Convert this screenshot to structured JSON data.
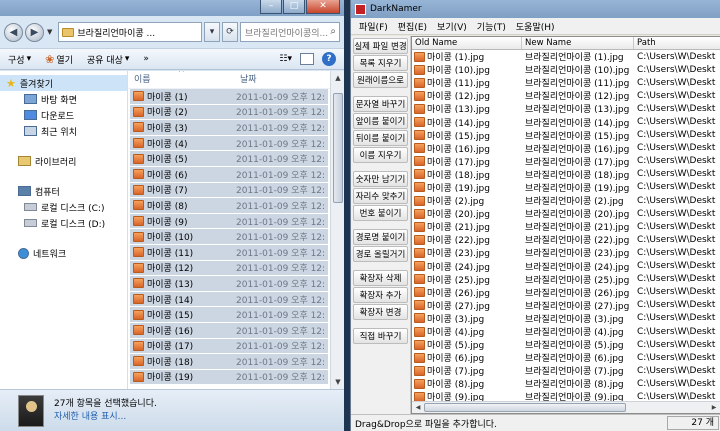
{
  "explorer": {
    "address": "브라질리언마이콩 ...",
    "search_placeholder": "브라질리언마이콩의...",
    "toolbar": {
      "organize": "구성",
      "open": "열기",
      "share": "공유 대상",
      "more": "»"
    },
    "nav": {
      "favorites": "즐겨찾기",
      "desktop": "바탕 화면",
      "downloads": "다운로드",
      "recent": "최근 위치",
      "libraries": "라이브러리",
      "computer": "컴퓨터",
      "drive_c": "로컬 디스크 (C:)",
      "drive_d": "로컬 디스크 (D:)",
      "network": "네트워크"
    },
    "columns": {
      "name": "이름",
      "date": "날짜"
    },
    "files": [
      {
        "name": "마이콩 (1)",
        "date": "2011-01-09 오후 12:"
      },
      {
        "name": "마이콩 (2)",
        "date": "2011-01-09 오후 12:"
      },
      {
        "name": "마이콩 (3)",
        "date": "2011-01-09 오후 12:"
      },
      {
        "name": "마이콩 (4)",
        "date": "2011-01-09 오후 12:"
      },
      {
        "name": "마이콩 (5)",
        "date": "2011-01-09 오후 12:"
      },
      {
        "name": "마이콩 (6)",
        "date": "2011-01-09 오후 12:"
      },
      {
        "name": "마이콩 (7)",
        "date": "2011-01-09 오후 12:"
      },
      {
        "name": "마이콩 (8)",
        "date": "2011-01-09 오후 12:"
      },
      {
        "name": "마이콩 (9)",
        "date": "2011-01-09 오후 12:"
      },
      {
        "name": "마이콩 (10)",
        "date": "2011-01-09 오후 12:"
      },
      {
        "name": "마이콩 (11)",
        "date": "2011-01-09 오후 12:"
      },
      {
        "name": "마이콩 (12)",
        "date": "2011-01-09 오후 12:"
      },
      {
        "name": "마이콩 (13)",
        "date": "2011-01-09 오후 12:"
      },
      {
        "name": "마이콩 (14)",
        "date": "2011-01-09 오후 12:"
      },
      {
        "name": "마이콩 (15)",
        "date": "2011-01-09 오후 12:"
      },
      {
        "name": "마이콩 (16)",
        "date": "2011-01-09 오후 12:"
      },
      {
        "name": "마이콩 (17)",
        "date": "2011-01-09 오후 12:"
      },
      {
        "name": "마이콩 (18)",
        "date": "2011-01-09 오후 12:"
      },
      {
        "name": "마이콩 (19)",
        "date": "2011-01-09 오후 12:"
      }
    ],
    "status": {
      "selected": "27개 항목을 선택했습니다.",
      "details": "자세한 내용 표시..."
    }
  },
  "darknamer": {
    "title": "DarkNamer",
    "menu": [
      "파일(F)",
      "편집(E)",
      "보기(V)",
      "기능(T)",
      "도움말(H)"
    ],
    "buttons": [
      "실제 파일 변경",
      "목록 지우기",
      "원래이름으로",
      "문자열 바꾸기",
      "앞이름 붙이기",
      "뒤이름 붙이기",
      "이름 지우기",
      "숫자만 남기기",
      "자리수 맞추기",
      "번호 붙이기",
      "경로명 붙이기",
      "경로 올릴거기",
      "확장자 삭제",
      "확장자 추가",
      "확장자 변경",
      "직접 바꾸기"
    ],
    "columns": {
      "old": "Old Name",
      "new": "New Name",
      "path": "Path"
    },
    "rows": [
      {
        "old": "마이콩 (1).jpg",
        "new": "브라질리언마이콩 (1).jpg",
        "path": "C:\\Users\\W\\Deskt"
      },
      {
        "old": "마이콩 (10).jpg",
        "new": "브라질리언마이콩 (10).jpg",
        "path": "C:\\Users\\W\\Deskt"
      },
      {
        "old": "마이콩 (11).jpg",
        "new": "브라질리언마이콩 (11).jpg",
        "path": "C:\\Users\\W\\Deskt"
      },
      {
        "old": "마이콩 (12).jpg",
        "new": "브라질리언마이콩 (12).jpg",
        "path": "C:\\Users\\W\\Deskt"
      },
      {
        "old": "마이콩 (13).jpg",
        "new": "브라질리언마이콩 (13).jpg",
        "path": "C:\\Users\\W\\Deskt"
      },
      {
        "old": "마이콩 (14).jpg",
        "new": "브라질리언마이콩 (14).jpg",
        "path": "C:\\Users\\W\\Deskt"
      },
      {
        "old": "마이콩 (15).jpg",
        "new": "브라질리언마이콩 (15).jpg",
        "path": "C:\\Users\\W\\Deskt"
      },
      {
        "old": "마이콩 (16).jpg",
        "new": "브라질리언마이콩 (16).jpg",
        "path": "C:\\Users\\W\\Deskt"
      },
      {
        "old": "마이콩 (17).jpg",
        "new": "브라질리언마이콩 (17).jpg",
        "path": "C:\\Users\\W\\Deskt"
      },
      {
        "old": "마이콩 (18).jpg",
        "new": "브라질리언마이콩 (18).jpg",
        "path": "C:\\Users\\W\\Deskt"
      },
      {
        "old": "마이콩 (19).jpg",
        "new": "브라질리언마이콩 (19).jpg",
        "path": "C:\\Users\\W\\Deskt"
      },
      {
        "old": "마이콩 (2).jpg",
        "new": "브라질리언마이콩 (2).jpg",
        "path": "C:\\Users\\W\\Deskt"
      },
      {
        "old": "마이콩 (20).jpg",
        "new": "브라질리언마이콩 (20).jpg",
        "path": "C:\\Users\\W\\Deskt"
      },
      {
        "old": "마이콩 (21).jpg",
        "new": "브라질리언마이콩 (21).jpg",
        "path": "C:\\Users\\W\\Deskt"
      },
      {
        "old": "마이콩 (22).jpg",
        "new": "브라질리언마이콩 (22).jpg",
        "path": "C:\\Users\\W\\Deskt"
      },
      {
        "old": "마이콩 (23).jpg",
        "new": "브라질리언마이콩 (23).jpg",
        "path": "C:\\Users\\W\\Deskt"
      },
      {
        "old": "마이콩 (24).jpg",
        "new": "브라질리언마이콩 (24).jpg",
        "path": "C:\\Users\\W\\Deskt"
      },
      {
        "old": "마이콩 (25).jpg",
        "new": "브라질리언마이콩 (25).jpg",
        "path": "C:\\Users\\W\\Deskt"
      },
      {
        "old": "마이콩 (26).jpg",
        "new": "브라질리언마이콩 (26).jpg",
        "path": "C:\\Users\\W\\Deskt"
      },
      {
        "old": "마이콩 (27).jpg",
        "new": "브라질리언마이콩 (27).jpg",
        "path": "C:\\Users\\W\\Deskt"
      },
      {
        "old": "마이콩 (3).jpg",
        "new": "브라질리언마이콩 (3).jpg",
        "path": "C:\\Users\\W\\Deskt"
      },
      {
        "old": "마이콩 (4).jpg",
        "new": "브라질리언마이콩 (4).jpg",
        "path": "C:\\Users\\W\\Deskt"
      },
      {
        "old": "마이콩 (5).jpg",
        "new": "브라질리언마이콩 (5).jpg",
        "path": "C:\\Users\\W\\Deskt"
      },
      {
        "old": "마이콩 (6).jpg",
        "new": "브라질리언마이콩 (6).jpg",
        "path": "C:\\Users\\W\\Deskt"
      },
      {
        "old": "마이콩 (7).jpg",
        "new": "브라질리언마이콩 (7).jpg",
        "path": "C:\\Users\\W\\Deskt"
      },
      {
        "old": "마이콩 (8).jpg",
        "new": "브라질리언마이콩 (8).jpg",
        "path": "C:\\Users\\W\\Deskt"
      },
      {
        "old": "마이콩 (9).jpg",
        "new": "브라질리언마이콩 (9).jpg",
        "path": "C:\\Users\\W\\Deskt"
      }
    ],
    "status": {
      "hint": "Drag&Drop으로 파일을 추가합니다.",
      "count": "27 개"
    }
  }
}
